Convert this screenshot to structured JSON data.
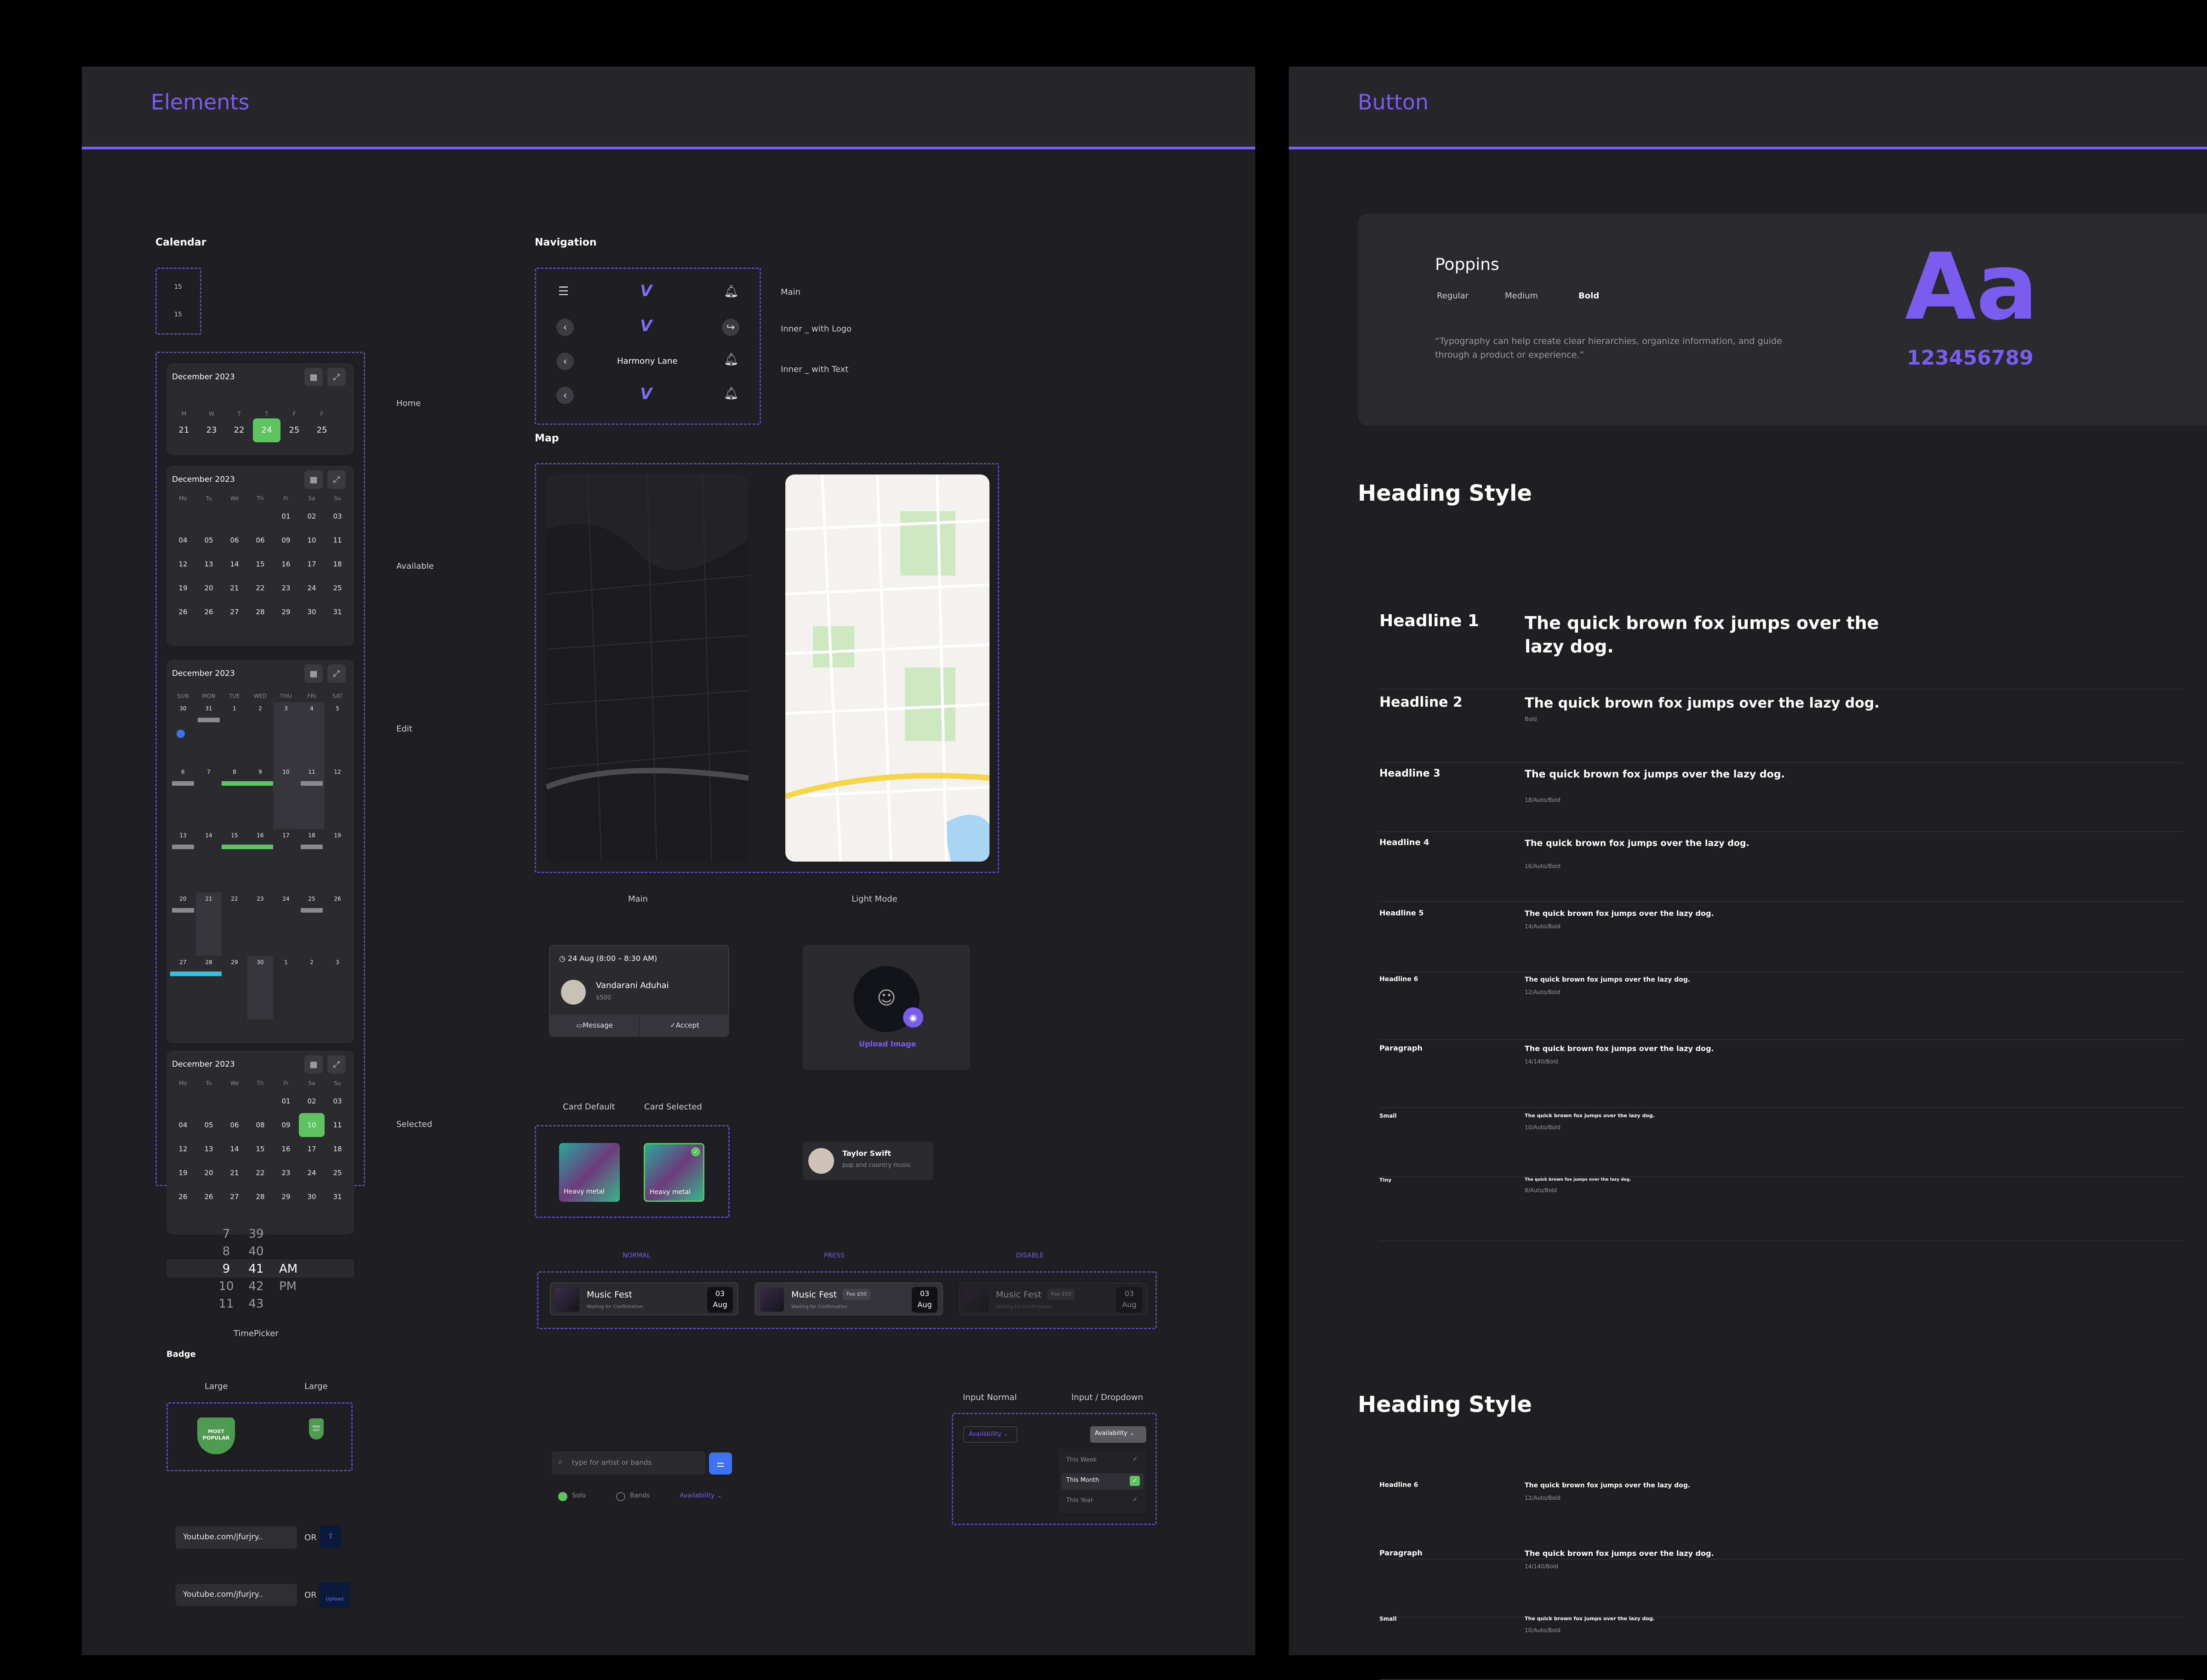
{
  "colors": {
    "accent": "#7b5cf0",
    "green": "#5ec461",
    "background": "#1e1e20",
    "card": "#2b2b2f"
  },
  "left_panel": {
    "title": "Elements",
    "calendar": {
      "section_title": "Calendar",
      "mini": [
        "15",
        "15"
      ],
      "home": {
        "month": "December 2023",
        "weekdays": [
          "M",
          "W",
          "T",
          "T",
          "F",
          "F"
        ],
        "days": [
          "21",
          "23",
          "22",
          "24",
          "25",
          "25"
        ],
        "selected": "24",
        "label": "Home"
      },
      "available": {
        "month": "December 2023",
        "weekdays": [
          "Mo",
          "Tu",
          "We",
          "Th",
          "Fr",
          "Sa",
          "Su"
        ],
        "rows": [
          [
            "",
            "",
            "",
            "",
            "01",
            "02",
            "03"
          ],
          [
            "04",
            "05",
            "06",
            "06",
            "09",
            "10",
            "11"
          ],
          [
            "12",
            "13",
            "14",
            "15",
            "16",
            "17",
            "18"
          ],
          [
            "19",
            "20",
            "21",
            "22",
            "23",
            "24",
            "25"
          ],
          [
            "26",
            "26",
            "27",
            "28",
            "29",
            "30",
            "31"
          ]
        ],
        "label": "Available"
      },
      "edit": {
        "month": "December 2023",
        "weekdays": [
          "SUN",
          "MON",
          "TUE",
          "WED",
          "THU",
          "FRI",
          "SAT"
        ],
        "rows": [
          [
            "30",
            "31",
            "1",
            "2",
            "3",
            "4",
            "5"
          ],
          [
            "6",
            "7",
            "8",
            "9",
            "10",
            "11",
            "12"
          ],
          [
            "13",
            "14",
            "15",
            "16",
            "17",
            "18",
            "19"
          ],
          [
            "20",
            "21",
            "22",
            "23",
            "24",
            "25",
            "26"
          ],
          [
            "27",
            "28",
            "29",
            "30",
            "1",
            "2",
            "3"
          ]
        ],
        "label": "Edit"
      },
      "selected": {
        "month": "December 2023",
        "weekdays": [
          "Mo",
          "Tu",
          "We",
          "Th",
          "Fr",
          "Sa",
          "Su"
        ],
        "rows": [
          [
            "",
            "",
            "",
            "",
            "01",
            "02",
            "03"
          ],
          [
            "04",
            "05",
            "06",
            "08",
            "09",
            "10",
            "11"
          ],
          [
            "12",
            "13",
            "14",
            "15",
            "16",
            "17",
            "18"
          ],
          [
            "19",
            "20",
            "21",
            "22",
            "23",
            "24",
            "25"
          ],
          [
            "26",
            "26",
            "27",
            "28",
            "29",
            "30",
            "31"
          ]
        ],
        "selected_day": "10",
        "label": "Selected"
      }
    },
    "timepicker": {
      "hours": [
        "7",
        "8",
        "9",
        "10",
        "11"
      ],
      "minutes": [
        "39",
        "40",
        "41",
        "42",
        "43"
      ],
      "ampm": [
        "AM",
        "PM"
      ],
      "label": "TimePicker"
    },
    "badge": {
      "section_title": "Badge",
      "col1": "Large",
      "col2": "Large",
      "badge1": "MOST POPULAR",
      "badge2": "NEW HOT"
    },
    "youtube": [
      {
        "value": "Youtube.com/jfurjry..",
        "or": "OR"
      },
      {
        "value": "Youtube.com/jfurjry..",
        "or": "OR",
        "upload": "Upload"
      }
    ],
    "navigation": {
      "section_title": "Navigation",
      "labels": [
        "Main",
        "Inner _ with Logo",
        "Inner _ with Text"
      ],
      "text_title": "Harmony Lane"
    },
    "map": {
      "section_title": "Map",
      "main": "Main",
      "light": "Light Mode"
    },
    "booking": {
      "time": "24 Aug (8:00 – 8:30 AM)",
      "name": "Vandarani Aduhai",
      "price": "$500",
      "message": "Message",
      "accept": "Accept"
    },
    "upload": {
      "label": "Upload Image"
    },
    "cards": {
      "default": "Card Default",
      "selected": "Card Selected",
      "item": "Heavy metal"
    },
    "artist": {
      "name": "Taylor Swift",
      "genre": "pop and country music"
    },
    "states": {
      "normal": "NORMAL",
      "press": "PRESS",
      "disable": "DISABLE"
    },
    "music": {
      "title": "Music Fest",
      "sub": "Waiting for Confirmation",
      "fee": "Fee $50",
      "day": "03",
      "month": "Aug"
    },
    "search": {
      "placeholder": "type for artist or bands",
      "solo": "Solo",
      "bands": "Bands",
      "availability": "Availability"
    },
    "inputs": {
      "normal": "Input Normal",
      "dropdown": "Input / Dropdown",
      "field": "Availability",
      "options": [
        "This Week",
        "This Month",
        "This Year"
      ]
    }
  },
  "right_panel": {
    "title": "Button",
    "typography": {
      "font": "Poppins",
      "weights": [
        "Regular",
        "Medium",
        "Bold"
      ],
      "quote": "“Typography can help create clear hierarchies, organize information, and guide through a product or experience.”",
      "big": "Aa",
      "digits": "123456789"
    },
    "heading_style": "Heading Style",
    "rows": [
      {
        "name": "Headline 1",
        "sample": "The  quick brown fox jumps over the lazy dog.",
        "meta": ""
      },
      {
        "name": "Headline 2",
        "sample": "The  quick brown fox jumps over the lazy dog.",
        "meta": "Bold"
      },
      {
        "name": "Headline 3",
        "sample": "The  quick brown fox jumps over the lazy dog.",
        "meta": "18/Auto/Bold"
      },
      {
        "name": "Headline 4",
        "sample": "The  quick brown fox jumps over the lazy dog.",
        "meta": "16/Auto/Bold"
      },
      {
        "name": "Headline 5",
        "sample": "The  quick brown fox jumps over the lazy dog.",
        "meta": "14/Auto/Bold"
      },
      {
        "name": "Headline 6",
        "sample": "The  quick brown fox jumps over the lazy dog.",
        "meta": "12/Auto/Bold"
      },
      {
        "name": "Paragraph",
        "sample": "The  quick brown fox jumps over the lazy dog.",
        "meta": "14/140/Bold"
      },
      {
        "name": "Small",
        "sample": "The  quick brown fox jumps over the lazy dog.",
        "meta": "10/Auto/Bold"
      },
      {
        "name": "Tiny",
        "sample": "The  quick brown fox jumps over the lazy dog.",
        "meta": "8/Auto/Bold"
      }
    ],
    "rows2": [
      {
        "name": "Headline 6",
        "sample": "The  quick brown fox jumps over the lazy dog.",
        "meta": "12/Auto/Bold"
      },
      {
        "name": "Paragraph",
        "sample": "The  quick brown fox jumps over the lazy dog.",
        "meta": "14/140/Bold"
      },
      {
        "name": "Small",
        "sample": "The  quick brown fox jumps over the lazy dog.",
        "meta": "10/Auto/Bold"
      }
    ]
  }
}
